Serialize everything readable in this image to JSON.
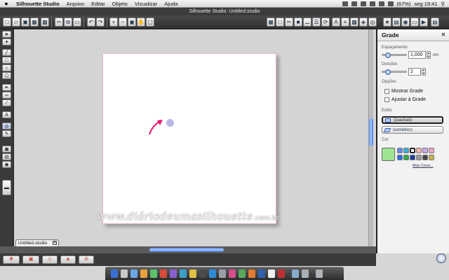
{
  "menubar": {
    "apple": "",
    "app_name": "Silhouette Studio",
    "items": [
      "Arquivo",
      "Editar",
      "Objeto",
      "Visualizar",
      "Ajuda"
    ],
    "battery": "(67%)",
    "clock": "seg 19:41"
  },
  "window": {
    "title": "Silhouette Studio: Untitled.studio"
  },
  "document": {
    "tab_label": "Untitled.studio",
    "tab_close": "✕"
  },
  "watermark": {
    "text": "www.diáriodeumasilhouette",
    "suffix": ".com.br"
  },
  "panel": {
    "title": "Grade",
    "close": "✕",
    "spacing_label": "Espaçamento",
    "spacing_value": "1,000",
    "spacing_unit": "cm",
    "divisions_label": "Divisões",
    "divisions_value": "2",
    "options_label": "Opções",
    "show_grid": "Mostrar Grade",
    "snap_grid": "Ajustar à Grade",
    "style_label": "Estilo",
    "style_square": "Quadrado",
    "style_isometric": "Isométrico",
    "color_label": "Cor",
    "more_colors": "Mais Cores..."
  },
  "colors": {
    "accent_arrow": "#e5166b",
    "grid_dot": "#b9b7e6",
    "selected_color": "#9ee493"
  },
  "icons": {
    "toolbar": [
      "new-document-icon",
      "open-icon",
      "save-icon",
      "print-icon",
      "cut-icon",
      "copy-icon",
      "paste-icon",
      "undo-icon",
      "redo-icon",
      "zoom-in-icon",
      "zoom-out-icon",
      "zoom-fit-icon",
      "pan-icon",
      "grid-icon",
      "align-icon",
      "fill-icon",
      "line-style-icon",
      "text-style-icon",
      "cut-settings-icon"
    ],
    "left_tools": [
      "select-icon",
      "edit-points-icon",
      "line-icon",
      "rectangle-icon",
      "ellipse-icon",
      "polygon-icon",
      "pen-icon",
      "knife-icon",
      "text-icon",
      "grid-settings-icon",
      "eraser-icon",
      "library-icon",
      "store-icon",
      "design-area-icon"
    ]
  }
}
